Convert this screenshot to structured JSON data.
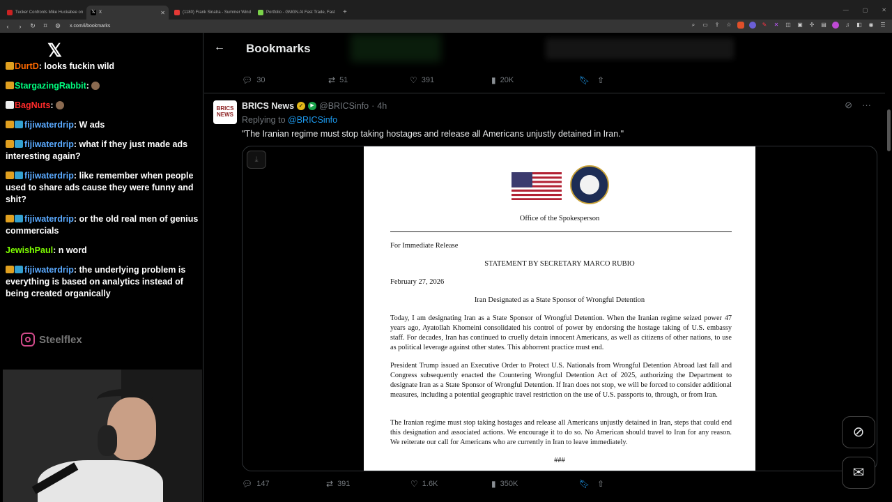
{
  "browser": {
    "tabs": [
      {
        "title": "Tucker Confronts Mike Huckabee on",
        "color": "#cc2222"
      },
      {
        "title": "X",
        "color": "#ffffff",
        "active": true
      },
      {
        "title": "(1180) Frank Sinatra - Summer Wind",
        "color": "#e53935"
      },
      {
        "title": "Portfolio - GMGN.AI Fast Trade, Fast",
        "color": "#7bd34a"
      }
    ],
    "new_tab": "+",
    "url": "x.com/i/bookmarks"
  },
  "chat": {
    "messages": [
      {
        "user": "DurtD",
        "text": ": looks fuckin wild",
        "color": "#ff6a00"
      },
      {
        "user": "StargazingRabbit",
        "text": ":",
        "color": "#00ff7f"
      },
      {
        "user": "BagNuts",
        "text": ":",
        "color": "#ff2a2a"
      },
      {
        "user": "fijiwaterdrip",
        "text": ": W ads",
        "color": "#5aaaff"
      },
      {
        "user": "fijiwaterdrip",
        "text": ": what if they just made ads interesting again?",
        "color": "#5aaaff"
      },
      {
        "user": "fijiwaterdrip",
        "text": ": like remember when people used to share ads cause they were funny and shit?",
        "color": "#5aaaff"
      },
      {
        "user": "fijiwaterdrip",
        "text": ": or the old real men of genius commercials",
        "color": "#5aaaff"
      },
      {
        "user": "JewishPaul",
        "text": ": n word",
        "color": "#7fff00"
      },
      {
        "user": "fijiwaterdrip",
        "text": ": the underlying problem is everything is based on analytics instead of being created organically",
        "color": "#5aaaff"
      }
    ],
    "instagram_handle": "Steelflex"
  },
  "header": {
    "title": "Bookmarks"
  },
  "prev_tweet": {
    "replies": "30",
    "retweets": "51",
    "likes": "391",
    "views": "20K"
  },
  "tweet": {
    "avatar_text": "BRICS NEWS",
    "name": "BRICS News",
    "handle": "@BRICSinfo",
    "dot": "·",
    "time": "4h",
    "replying_label": "Replying to",
    "replying_to": "@BRICSinfo",
    "text": "\"The Iranian regime must stop taking hostages and release all Americans unjustly detained in Iran.\"",
    "replies": "147",
    "retweets": "391",
    "likes": "1.6K",
    "views": "350K"
  },
  "document": {
    "office": "Office of the Spokesperson",
    "release": "For Immediate Release",
    "heading": "STATEMENT BY SECRETARY MARCO RUBIO",
    "date": "February 27, 2026",
    "subheading": "Iran Designated as a State Sponsor of Wrongful Detention",
    "para1": "Today, I am designating Iran as a State Sponsor of Wrongful Detention. When the Iranian regime seized power 47 years ago, Ayatollah Khomeini consolidated his control of power by endorsing the hostage taking of U.S. embassy staff. For decades, Iran has continued to cruelly detain innocent Americans, as well as citizens of other nations, to use as political leverage against other states. This abhorrent practice must end.",
    "para2": "President Trump issued an Executive Order to Protect U.S. Nationals from Wrongful Detention Abroad last fall and Congress subsequently enacted the Countering Wrongful Detention Act of 2025, authorizing the Department to designate Iran as a State Sponsor of Wrongful Detention. If Iran does not stop, we will be forced to consider additional measures, including a potential geographic travel restriction on the use of U.S. passports to, through, or from Iran.",
    "para3": "The Iranian regime must stop taking hostages and release all Americans unjustly detained in Iran, steps that could end this designation and associated actions. We encourage it to do so. No American should travel to Iran for any reason. We reiterate our call for Americans who are currently in Iran to leave immediately.",
    "end_mark": "###"
  },
  "colors": {
    "accent": "#1d9bf0",
    "bg": "#000000",
    "muted": "#71767b"
  }
}
